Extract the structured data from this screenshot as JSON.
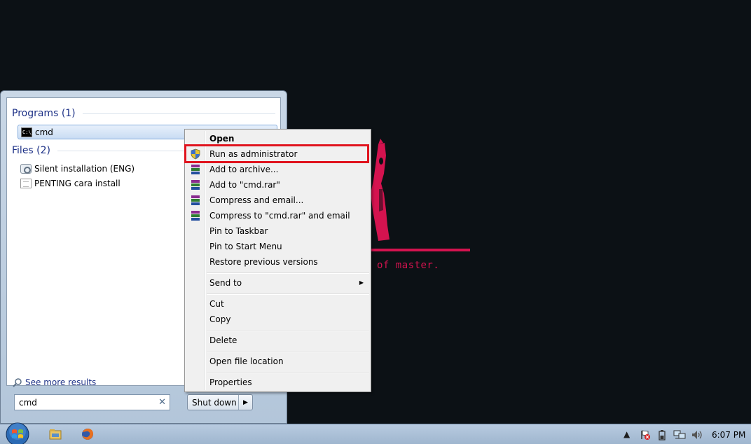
{
  "wallpaper": {
    "caption": "of master.",
    "accent_color": "#d4134f"
  },
  "start_menu": {
    "programs_header": "Programs (1)",
    "programs": [
      {
        "label": "cmd",
        "icon": "cmd-icon"
      }
    ],
    "files_header": "Files (2)",
    "files": [
      {
        "label": "Silent installation (ENG)",
        "icon": "settings-file-icon"
      },
      {
        "label": "PENTING cara install",
        "icon": "text-document-icon"
      }
    ],
    "see_more": "See more results",
    "search": {
      "value": "cmd"
    },
    "shutdown_label": "Shut down"
  },
  "context_menu": {
    "items": [
      {
        "label": "Open"
      },
      {
        "label": "Run as administrator",
        "icon": "uac-shield-icon"
      },
      {
        "label": "Add to archive...",
        "icon": "winrar-icon"
      },
      {
        "label": "Add to \"cmd.rar\"",
        "icon": "winrar-icon"
      },
      {
        "label": "Compress and email...",
        "icon": "winrar-icon"
      },
      {
        "label": "Compress to \"cmd.rar\" and email",
        "icon": "winrar-icon"
      },
      {
        "label": "Pin to Taskbar"
      },
      {
        "label": "Pin to Start Menu"
      },
      {
        "label": "Restore previous versions"
      },
      {
        "label": "Send to"
      },
      {
        "label": "Cut"
      },
      {
        "label": "Copy"
      },
      {
        "label": "Delete"
      },
      {
        "label": "Open file location"
      },
      {
        "label": "Properties"
      }
    ],
    "highlight_color": "#e0141e"
  },
  "taskbar": {
    "clock": "6:07 PM"
  }
}
